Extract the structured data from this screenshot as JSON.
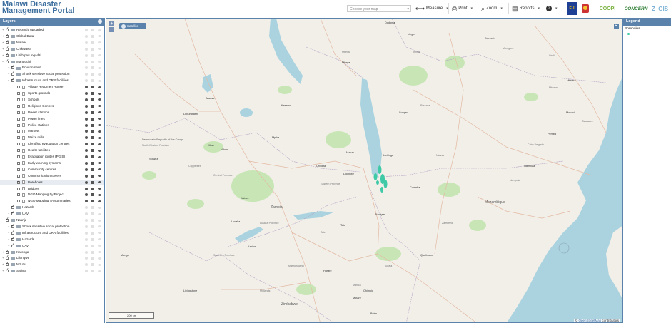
{
  "header": {
    "title_line1": "Malawi Disaster",
    "title_line2": "Management Portal",
    "map_select_placeholder": "Choose your map",
    "tools": [
      {
        "label": "Measure",
        "icon": "ruler-icon"
      },
      {
        "label": "Print",
        "icon": "printer-icon"
      },
      {
        "label": "Zoom",
        "icon": "magnifier-icon"
      },
      {
        "label": "Reports",
        "icon": "document-icon"
      },
      {
        "label": "",
        "icon": "help-icon"
      }
    ],
    "partners": {
      "eu": "EU",
      "coopi": "COOPI",
      "concern": "CONCERN",
      "zgis": "Z_GIS"
    }
  },
  "layers_panel": {
    "title": "Layers",
    "rows": [
      {
        "label": "Recently uploaded",
        "depth": 0,
        "twisty": "+",
        "checked": true,
        "kind": "folder",
        "active": false
      },
      {
        "label": "Global Data",
        "depth": 0,
        "twisty": "+",
        "checked": true,
        "kind": "folder",
        "active": false
      },
      {
        "label": "Malawi",
        "depth": 0,
        "twisty": "+",
        "checked": true,
        "kind": "folder",
        "active": false
      },
      {
        "label": "Chikwawa",
        "depth": 0,
        "twisty": "+",
        "checked": true,
        "kind": "folder",
        "active": false
      },
      {
        "label": "Lirithipe/Lingadzi",
        "depth": 0,
        "twisty": "+",
        "checked": true,
        "kind": "folder",
        "active": false
      },
      {
        "label": "Mangochi",
        "depth": 0,
        "twisty": "−",
        "checked": true,
        "kind": "folder",
        "active": false
      },
      {
        "label": "Environment",
        "depth": 1,
        "twisty": "+",
        "checked": true,
        "kind": "folder",
        "active": false
      },
      {
        "label": "Shock sensitive social protection",
        "depth": 1,
        "twisty": "+",
        "checked": true,
        "kind": "folder",
        "active": false
      },
      {
        "label": "Infrastructure and DRR facilities",
        "depth": 1,
        "twisty": "−",
        "checked": true,
        "kind": "folder",
        "active": false
      },
      {
        "label": "Village Headmen House",
        "depth": 2,
        "twisty": "",
        "checked": false,
        "kind": "page",
        "active": true
      },
      {
        "label": "Sports grounds",
        "depth": 2,
        "twisty": "",
        "checked": false,
        "kind": "page",
        "active": true
      },
      {
        "label": "Schools",
        "depth": 2,
        "twisty": "",
        "checked": false,
        "kind": "page",
        "active": true
      },
      {
        "label": "Religious Centres",
        "depth": 2,
        "twisty": "",
        "checked": false,
        "kind": "page",
        "active": true
      },
      {
        "label": "Power stations",
        "depth": 2,
        "twisty": "",
        "checked": false,
        "kind": "page",
        "active": true
      },
      {
        "label": "Power lines",
        "depth": 2,
        "twisty": "",
        "checked": false,
        "kind": "page",
        "active": true
      },
      {
        "label": "Police stations",
        "depth": 2,
        "twisty": "",
        "checked": false,
        "kind": "page",
        "active": true
      },
      {
        "label": "Markets",
        "depth": 2,
        "twisty": "",
        "checked": false,
        "kind": "page",
        "active": true
      },
      {
        "label": "Maize mills",
        "depth": 2,
        "twisty": "",
        "checked": false,
        "kind": "page",
        "active": true
      },
      {
        "label": "Identified evacuation centres",
        "depth": 2,
        "twisty": "",
        "checked": false,
        "kind": "page",
        "active": true
      },
      {
        "label": "Health facilities",
        "depth": 2,
        "twisty": "",
        "checked": false,
        "kind": "page",
        "active": true
      },
      {
        "label": "Evacuation routes (PGIS)",
        "depth": 2,
        "twisty": "",
        "checked": false,
        "kind": "page",
        "active": true
      },
      {
        "label": "Early warning systems",
        "depth": 2,
        "twisty": "",
        "checked": false,
        "kind": "page",
        "active": true
      },
      {
        "label": "Community centres",
        "depth": 2,
        "twisty": "",
        "checked": false,
        "kind": "page",
        "active": true
      },
      {
        "label": "Communication towers",
        "depth": 2,
        "twisty": "",
        "checked": false,
        "kind": "page",
        "active": true
      },
      {
        "label": "Boreholes",
        "depth": 2,
        "twisty": "",
        "checked": true,
        "kind": "page",
        "active": true,
        "selected": true
      },
      {
        "label": "Bridges",
        "depth": 2,
        "twisty": "",
        "checked": false,
        "kind": "page",
        "active": true
      },
      {
        "label": "NGO Mapping by Project",
        "depth": 2,
        "twisty": "",
        "checked": false,
        "kind": "page",
        "active": true
      },
      {
        "label": "NGO Mapping TA summaries",
        "depth": 2,
        "twisty": "",
        "checked": false,
        "kind": "page",
        "active": true
      },
      {
        "label": "Hazards",
        "depth": 1,
        "twisty": "+",
        "checked": true,
        "kind": "folder",
        "active": false
      },
      {
        "label": "UAV",
        "depth": 1,
        "twisty": "+",
        "checked": true,
        "kind": "folder",
        "active": false
      },
      {
        "label": "Nsanje",
        "depth": 0,
        "twisty": "−",
        "checked": true,
        "kind": "folder",
        "active": false
      },
      {
        "label": "Shock sensitive social protection",
        "depth": 1,
        "twisty": "+",
        "checked": true,
        "kind": "folder",
        "active": false
      },
      {
        "label": "Infrastructure and DRR facilities",
        "depth": 1,
        "twisty": "+",
        "checked": true,
        "kind": "folder",
        "active": false
      },
      {
        "label": "Hazards",
        "depth": 1,
        "twisty": "+",
        "checked": true,
        "kind": "folder",
        "active": false
      },
      {
        "label": "UAV",
        "depth": 1,
        "twisty": "+",
        "checked": true,
        "kind": "folder",
        "active": false
      },
      {
        "label": "Karonga",
        "depth": 0,
        "twisty": "+",
        "checked": true,
        "kind": "folder",
        "active": false
      },
      {
        "label": "Lilongwe",
        "depth": 0,
        "twisty": "+",
        "checked": true,
        "kind": "folder",
        "active": false
      },
      {
        "label": "Mzuzu",
        "depth": 0,
        "twisty": "+",
        "checked": true,
        "kind": "folder",
        "active": false
      },
      {
        "label": "Salima",
        "depth": 0,
        "twisty": "+",
        "checked": true,
        "kind": "folder",
        "active": false
      }
    ]
  },
  "map": {
    "zoom_in": "+",
    "zoom_out": "−",
    "basemap_button": "Satellite",
    "scale_label": "200 km",
    "attribution_prefix": "© ",
    "attribution_link": "OpenStreetMap",
    "attribution_suffix": " contributors",
    "labels": {
      "tanzania": "Tanzania",
      "dem_congo": "Democratic Republic of the Congo",
      "zambia": "Zambia",
      "mozambique": "Mozambique",
      "zimbabwe": "Zimbabwe",
      "comores": "Comores",
      "northwestern": "North-Western Province",
      "central_prov": "Central Province",
      "lusaka_prov": "Lusaka Province",
      "southern_prov": "Southern Province",
      "copperbelt": "Copperbelt",
      "eastern": "Eastern Province",
      "nampula": "Nampula",
      "tete": "Tete",
      "manica": "Manica",
      "sofala": "Sofala",
      "zambezia": "Zambézia",
      "niassa": "Niassa",
      "cabo": "Cabo Delgado",
      "mashonaland": "Mashonaland",
      "midlands": "Midlands",
      "morogoro": "Morogoro",
      "iringa": "Iringa",
      "mbeya": "Mbeya",
      "ruvuma": "Ruvuma",
      "mtwara": "Mtwara",
      "lindi": "Lindi"
    },
    "cities": {
      "lubumbashi": "Lubumbashi",
      "ndola": "Ndola",
      "kitwe": "Kitwe",
      "kabwe": "Kabwe",
      "lusaka": "Lusaka",
      "chipata": "Chipata",
      "lilongwe": "Lilongwe",
      "mzuzu": "Mzuzu",
      "blantyre": "Blantyre",
      "tete_c": "Tete",
      "harare": "Harare",
      "beira": "Beira",
      "nampula_c": "Nampula",
      "pemba": "Pemba",
      "moroni": "Moroni",
      "mbeya_c": "Mbeya",
      "iringa_c": "Iringa",
      "songea": "Songea",
      "lichinga": "Lichinga",
      "quelimane": "Quelimane",
      "dodoma": "Dodoma",
      "kasama": "Kasama",
      "mansa": "Mansa",
      "mpika": "Mpika",
      "livingstone": "Livingstone",
      "kariba": "Kariba",
      "mutare": "Mutare",
      "chimoio": "Chimoio",
      "cuamba": "Cuamba",
      "mtwara_c": "Mtwara",
      "solwezi": "Solwezi",
      "mongu": "Mongu"
    }
  },
  "legend": {
    "title": "Legend",
    "items": [
      {
        "label": "Boreholes",
        "color": "#3ec9a7"
      }
    ]
  },
  "colors": {
    "brand": "#5b82ab",
    "title": "#3d6e9e",
    "water": "#aad3df",
    "land": "#f2efe9",
    "forest": "#c8e6b5",
    "boreholes": "#3ec9a7"
  }
}
